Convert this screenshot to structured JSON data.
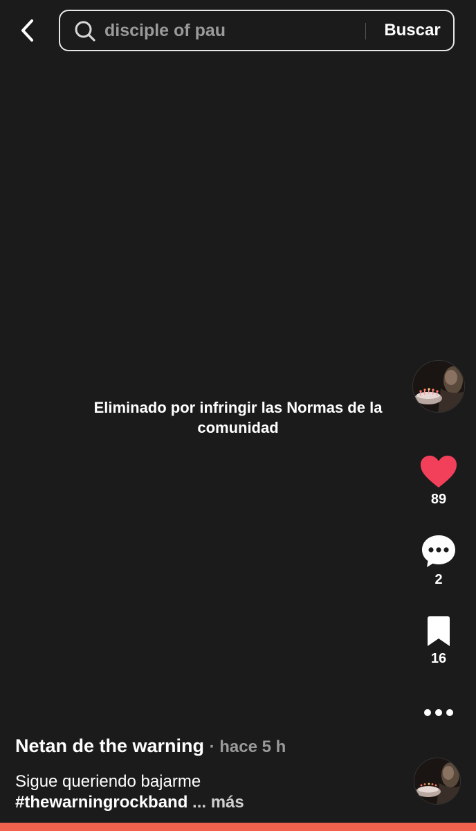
{
  "header": {
    "back_icon": "chevron-left-icon",
    "search_icon": "search-icon",
    "search_value": "disciple of pau",
    "search_button_label": "Buscar"
  },
  "video": {
    "removed_message": "Eliminado por infringir las Normas de la comunidad"
  },
  "actions": {
    "like_count": "89",
    "like_color": "#f2405a",
    "comment_count": "2",
    "save_count": "16",
    "more_icon": "more-dots-icon"
  },
  "post": {
    "author": "Netan de the warning",
    "time": "· hace 5 h",
    "caption_text": "Sigue queriendo bajarme",
    "hashtag": "#thewarningrockband",
    "ellipsis": " ... ",
    "more_label": "más"
  },
  "progress": {
    "fraction": 1.0,
    "color": "#f0614e"
  }
}
